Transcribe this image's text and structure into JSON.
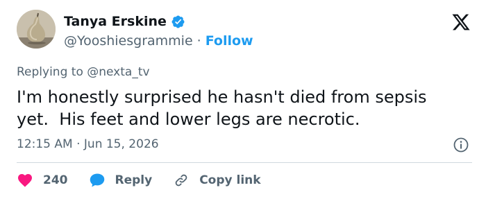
{
  "author": {
    "name": "Tanya Erskine",
    "handle": "@Yooshiesgrammie",
    "separator": "·",
    "follow_label": "Follow"
  },
  "reply_context": {
    "prefix": "Replying to ",
    "mention": "@nexta_tv"
  },
  "tweet": {
    "text": "I'm honestly surprised he hasn't died from sepsis\nyet.  His feet and lower legs are necrotic.",
    "timestamp": "12:15 AM · Jun 15, 2026"
  },
  "actions": {
    "like_count": "240",
    "reply_label": "Reply",
    "copy_link_label": "Copy link"
  },
  "colors": {
    "accent": "#1d9bf0",
    "like": "#f91880",
    "muted": "#536471"
  },
  "icons": {
    "verified": "verified-badge-icon",
    "brand": "x-logo-icon",
    "info": "info-icon",
    "like": "heart-icon",
    "reply": "speech-bubble-icon",
    "copy_link": "link-icon"
  }
}
